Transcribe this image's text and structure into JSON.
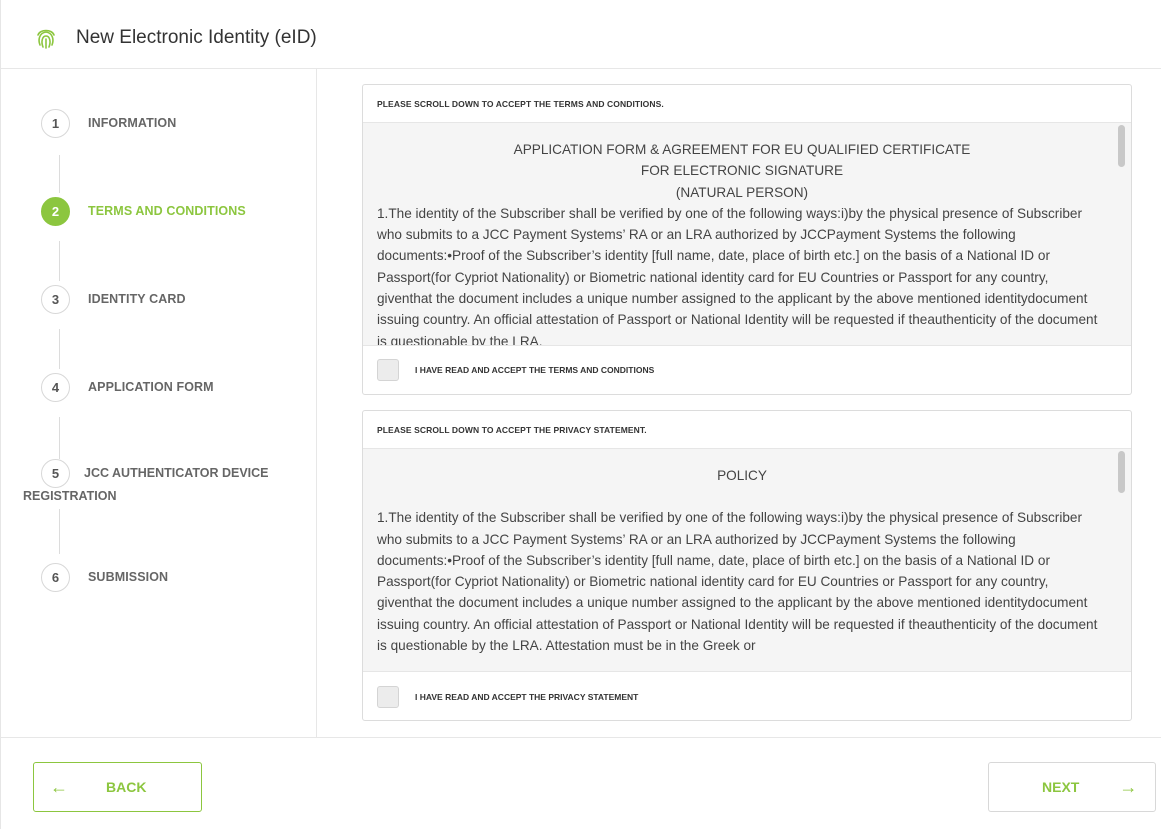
{
  "header": {
    "title": "New Electronic Identity (eID)",
    "logo_icon": "fingerprint-icon"
  },
  "accent_color": "#8cc63f",
  "steps": [
    {
      "num": "1",
      "label": "INFORMATION",
      "active": false
    },
    {
      "num": "2",
      "label": "TERMS AND CONDITIONS",
      "active": true
    },
    {
      "num": "3",
      "label": "IDENTITY CARD",
      "active": false
    },
    {
      "num": "4",
      "label": "APPLICATION FORM",
      "active": false
    },
    {
      "num": "5",
      "label": "JCC AUTHENTICATOR DEVICE REGISTRATION",
      "active": false
    },
    {
      "num": "6",
      "label": "SUBMISSION",
      "active": false
    }
  ],
  "terms": {
    "heading": "PLEASE SCROLL DOWN TO ACCEPT THE TERMS AND CONDITIONS.",
    "title_line1": "APPLICATION FORM & AGREEMENT FOR EU QUALIFIED CERTIFICATE",
    "title_line2": "FOR ELECTRONIC SIGNATURE",
    "title_line3": "(NATURAL PERSON)",
    "body": "1.The identity of the Subscriber shall be verified by one of the following ways:i)by the physical presence of Subscriber who submits to a JCC Payment Systems’ RA or an LRA authorized by JCCPayment Systems the following documents:•Proof of the Subscriber’s identity [full name, date, place of birth etc.] on the basis of a National ID or Passport(for Cypriot Nationality) or Biometric national identity card for EU Countries or Passport for any country, giventhat the document includes a unique number assigned to the applicant by the above mentioned identitydocument issuing country. An official attestation of Passport or National Identity will be requested if theauthenticity of the document is questionable by the LRA.",
    "accept_label": "I HAVE READ AND ACCEPT THE TERMS AND CONDITIONS",
    "accepted": false
  },
  "privacy": {
    "heading": "PLEASE SCROLL DOWN TO ACCEPT THE PRIVACY STATEMENT.",
    "title": "POLICY",
    "body": "1.The identity of the Subscriber shall be verified by one of the following ways:i)by the physical presence of Subscriber who submits to a JCC Payment Systems’ RA or an LRA authorized by JCCPayment Systems the following documents:•Proof of the Subscriber’s identity [full name, date, place of birth etc.] on the basis of a National ID or Passport(for Cypriot Nationality) or Biometric national identity card for EU Countries or Passport for any country, giventhat the document includes a unique number assigned to the applicant by the above mentioned identitydocument issuing country. An official attestation of Passport or National Identity will be requested if theauthenticity of the document is questionable by the LRA. Attestation must be in the Greek or",
    "accept_label": "I HAVE READ AND ACCEPT THE PRIVACY STATEMENT",
    "accepted": false
  },
  "footer": {
    "back_label": "BACK",
    "back_icon": "arrow-left-icon",
    "next_label": "NEXT",
    "next_icon": "arrow-right-icon"
  }
}
